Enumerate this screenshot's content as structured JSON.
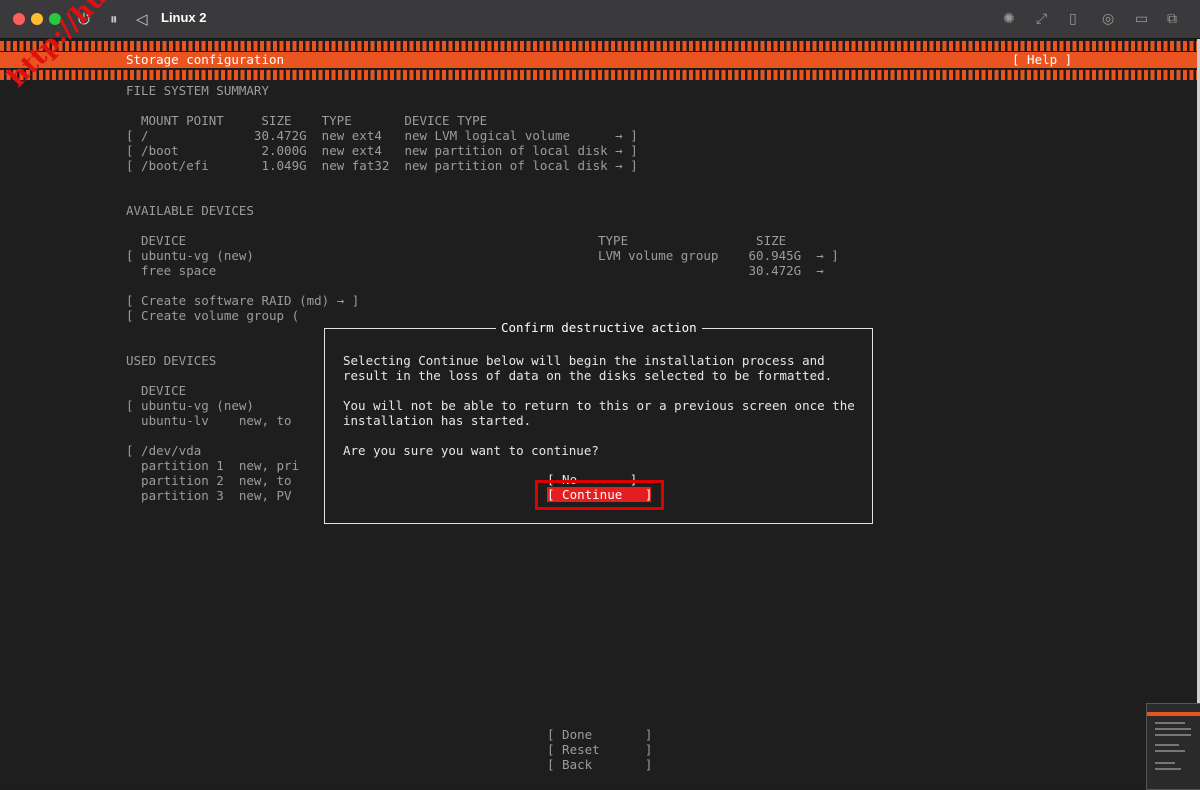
{
  "window": {
    "title": "Linux 2"
  },
  "header": {
    "title": "Storage configuration",
    "help": "[ Help ]"
  },
  "fs_summary": {
    "heading": "FILE SYSTEM SUMMARY",
    "columns": "MOUNT POINT     SIZE    TYPE       DEVICE TYPE",
    "rows": [
      "[ /              30.472G  new ext4   new LVM logical volume      → ]",
      "[ /boot           2.000G  new ext4   new partition of local disk → ]",
      "[ /boot/efi       1.049G  new fat32  new partition of local disk → ]"
    ]
  },
  "available": {
    "heading": "AVAILABLE DEVICES",
    "col_device": "DEVICE",
    "col_type": "TYPE                 SIZE",
    "row1_left": "[ ubuntu-vg (new)",
    "row1_right": "LVM volume group    60.945G  → ]",
    "row2_left": "  free space",
    "row2_right": "                    30.472G  →",
    "raid": "[ Create software RAID (md) → ]",
    "vg": "[ Create volume group ("
  },
  "used": {
    "heading": "USED DEVICES",
    "col_device": "DEVICE",
    "rows": [
      "[ ubuntu-vg (new)",
      "  ubuntu-lv    new, to",
      "",
      "[ /dev/vda",
      "  partition 1  new, pri",
      "  partition 2  new, to",
      "  partition 3  new, PV"
    ]
  },
  "dialog": {
    "title": "Confirm destructive action",
    "line1": "Selecting Continue below will begin the installation process and",
    "line2": "result in the loss of data on the disks selected to be formatted.",
    "line3": "You will not be able to return to this or a previous screen once the",
    "line4": "installation has started.",
    "question": "Are you sure you want to continue?",
    "no_button": "[ No       ]",
    "continue_button": "[ Continue   ]"
  },
  "footer": {
    "done": "[ Done       ]",
    "reset": "[ Reset      ]",
    "back": "[ Back       ]"
  },
  "watermark": "http://hulk.kr",
  "colors": {
    "accent": "#e95420",
    "highlight": "#e41e1e",
    "annotation": "#e00000"
  }
}
